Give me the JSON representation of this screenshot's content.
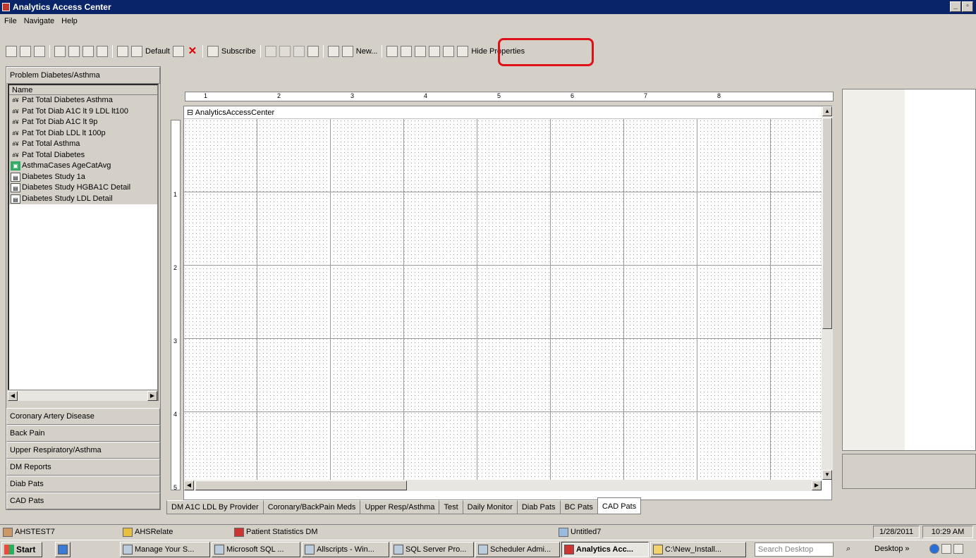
{
  "window": {
    "title": "Analytics Access Center"
  },
  "menu": [
    "File",
    "Navigate",
    "Help"
  ],
  "toolbar": {
    "default_label": "Default",
    "subscribe_label": "Subscribe",
    "new_label": "New...",
    "hide_properties_label": "Hide Properties",
    "highlight_color": "#e0101a"
  },
  "sidebar": {
    "active_group": "Problem Diabetes/Asthma",
    "list_header": "Name",
    "items": [
      {
        "label": "Pat Total Diabetes Asthma",
        "icon": "measure-icon"
      },
      {
        "label": "Pat Tot Diab A1C lt 9 LDL lt100",
        "icon": "measure-icon"
      },
      {
        "label": "Pat Tot Diab A1C  lt 9p",
        "icon": "measure-icon"
      },
      {
        "label": "Pat Tot Diab LDL lt 100p",
        "icon": "measure-icon"
      },
      {
        "label": "Pat Total Asthma",
        "icon": "measure-icon"
      },
      {
        "label": "Pat Total Diabetes",
        "icon": "measure-icon"
      },
      {
        "label": "AsthmaCases AgeCatAvg",
        "icon": "cube-icon"
      },
      {
        "label": "Diabetes Study 1a",
        "icon": "report-icon"
      },
      {
        "label": "Diabetes Study HGBA1C Detail",
        "icon": "report-icon"
      },
      {
        "label": "Diabetes Study LDL Detail",
        "icon": "report-icon"
      }
    ],
    "groups": [
      "Coronary Artery Disease",
      "Back Pain",
      "Upper Respiratory/Asthma",
      "DM Reports",
      "Diab Pats",
      "CAD Pats"
    ]
  },
  "designer": {
    "canvas_title": "AnalyticsAccessCenter",
    "ruler_top": [
      "1",
      "2",
      "3",
      "4",
      "5",
      "6",
      "7",
      "8"
    ],
    "ruler_left": [
      "1",
      "2",
      "3",
      "4",
      "5"
    ]
  },
  "tabs": [
    {
      "label": "DM A1C LDL By Provider"
    },
    {
      "label": "Coronary/BackPain Meds"
    },
    {
      "label": "Upper Resp/Asthma"
    },
    {
      "label": "Test"
    },
    {
      "label": "Daily Monitor"
    },
    {
      "label": "Diab Pats"
    },
    {
      "label": "BC Pats"
    },
    {
      "label": "CAD Pats",
      "active": true
    }
  ],
  "statusbar": {
    "server": "AHSTEST7",
    "database": "AHSRelate",
    "cube": "Patient Statistics DM",
    "document": "Untitled7",
    "date": "1/28/2011",
    "time": "10:29 AM"
  },
  "taskbar": {
    "start_label": "Start",
    "tasks": [
      "Manage Your S...",
      "Microsoft SQL ...",
      "Allscripts - Win...",
      "SQL Server Pro...",
      "Scheduler Admi...",
      "Analytics Acc...",
      "C:\\New_Install..."
    ],
    "active_task": "Analytics Acc...",
    "search_placeholder": "Search Desktop",
    "desktop_label": "Desktop"
  }
}
